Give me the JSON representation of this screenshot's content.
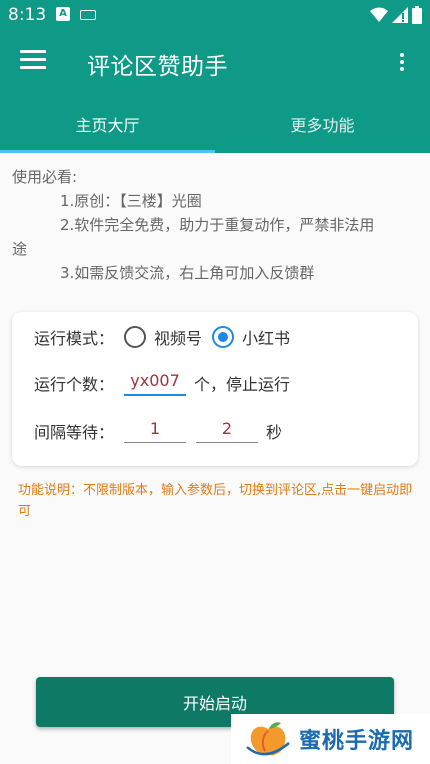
{
  "status_bar": {
    "time": "8:13",
    "notif_icon_letter": "A",
    "icons_right": [
      "wifi-icon",
      "signal-icon",
      "battery-icon"
    ]
  },
  "app_bar": {
    "title": "评论区赞助手"
  },
  "tabs": [
    {
      "label": "主页大厅",
      "active": true
    },
    {
      "label": "更多功能",
      "active": false
    }
  ],
  "instructions": {
    "heading": "使用必看:",
    "item1": "1.原创：【三楼】光圈",
    "item2_a": "2.软件完全免费，助力于重复动作，严禁非法用",
    "item2_b": "途",
    "item3": "3.如需反馈交流，右上角可加入反馈群"
  },
  "form": {
    "mode_label": "运行模式：",
    "mode_options": [
      {
        "label": "视频号",
        "checked": false
      },
      {
        "label": "小红书",
        "checked": true
      }
    ],
    "count_label": "运行个数：",
    "count_value": "yx007",
    "count_suffix": "个，停止运行",
    "interval_label": "间隔等待：",
    "interval_min": "1",
    "interval_max": "2",
    "interval_unit": "秒"
  },
  "description": "功能说明：不限制版本，输入参数后，切换到评论区,点击一键启动即可",
  "start_button": "开始启动",
  "watermark": "蜜桃手游网",
  "colors": {
    "primary": "#0e9a86",
    "button": "#0e7a66",
    "accent": "#1e88e5",
    "tab_indicator": "#4fc3f7",
    "desc_text": "#e07b1a",
    "value_text": "#a0323c"
  }
}
